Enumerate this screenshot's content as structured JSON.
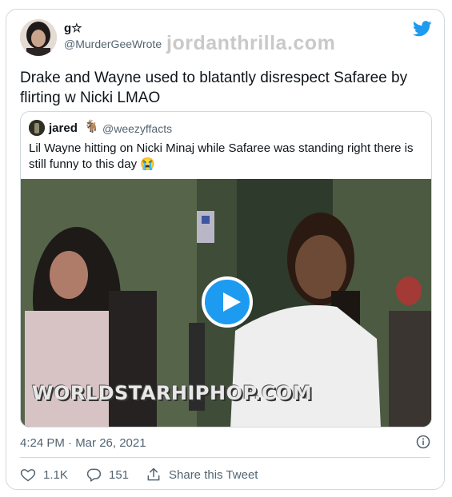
{
  "tweet": {
    "display_name": "g☆",
    "handle": "@MurderGeeWrote",
    "text": "Drake and Wayne used to blatantly disrespect Safaree by flirting w Nicki LMAO",
    "timestamp": "4:24 PM · Mar 26, 2021"
  },
  "watermark": "jordanthrilla.com",
  "quoted_tweet": {
    "display_name": "jared",
    "badge_emoji": "🐐",
    "handle": "@weezyffacts",
    "text": "Lil Wayne hitting on Nicki Minaj while Safaree was standing right there is still funny to this day 😭",
    "video_watermark": "WORLDSTARHIPHOP.COM"
  },
  "actions": {
    "likes": "1.1K",
    "replies": "151",
    "share_label": "Share this Tweet"
  },
  "colors": {
    "accent": "#1d9bf0",
    "text": "#0f1419",
    "secondary": "#536471",
    "border": "#cfd9de"
  },
  "icons": [
    "twitter-bird-icon",
    "play-icon",
    "info-icon",
    "heart-icon",
    "reply-icon",
    "share-icon"
  ]
}
